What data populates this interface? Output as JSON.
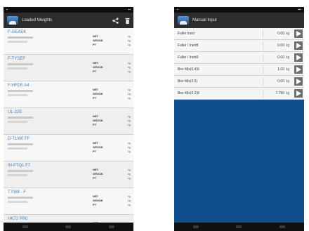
{
  "left": {
    "status_time": "",
    "title": "Loaded Weights",
    "items": [
      {
        "name": "F-GEAEK",
        "unit": "kg"
      },
      {
        "name": "F-TYSEF",
        "unit": "kg"
      },
      {
        "name": "F-HFDE A4",
        "unit": "kg"
      },
      {
        "name": "UL-22E",
        "unit": "kg"
      },
      {
        "name": "D-T1W0 FF",
        "unit": "kg"
      },
      {
        "name": "IN-PTQL F7",
        "unit": "kg"
      },
      {
        "name": "T7088 - F",
        "unit": "kg"
      },
      {
        "name": "HK72 PR0",
        "unit": "kg"
      }
    ],
    "row_keys": [
      "NET",
      "GROSS",
      "PT"
    ]
  },
  "right": {
    "status_time": "",
    "title": "Manual Input",
    "rows": [
      {
        "name": "Fuller Inert",
        "value": "0.00",
        "unit": "kg"
      },
      {
        "name": "Fuller / Inert8",
        "value": "0.00",
        "unit": "kg"
      },
      {
        "name": "Fuller / Inert9",
        "value": "0.00",
        "unit": "kg"
      },
      {
        "name": "Box Mix(0.4)6",
        "value": "1.00",
        "unit": "kg"
      },
      {
        "name": "Box Mix(0.5)",
        "value": "0.00",
        "unit": "kg"
      },
      {
        "name": "Box Mix(0.2)8",
        "value": "7.790",
        "unit": "kg"
      }
    ]
  },
  "colors": {
    "accent": "#3f84cc",
    "panel": "#0f4d8e",
    "bar": "#2c2c2c"
  }
}
